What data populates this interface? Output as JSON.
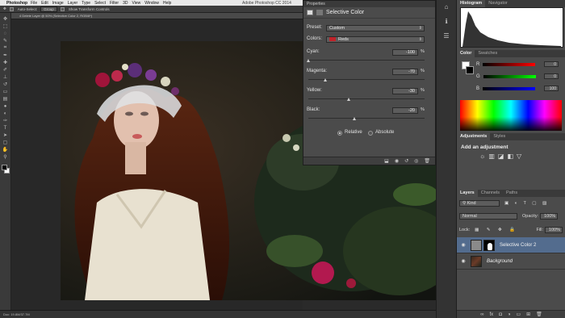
{
  "menubar": {
    "app": "Photoshop",
    "menus": [
      "File",
      "Edit",
      "Image",
      "Layer",
      "Type",
      "Select",
      "Filter",
      "3D",
      "View",
      "Window",
      "Help"
    ],
    "window_title": "Adobe Photoshop CC 2014"
  },
  "options_bar": {
    "auto_select_label": "Auto-Select:",
    "auto_select_value": "Group",
    "transform_label": "Show Transform Controls"
  },
  "document": {
    "tab_title": "4 Delete Layer @ 50% (Selective Color 2, RGB/8*)",
    "status": "Doc: 19.8M/37.7M"
  },
  "properties": {
    "tab": "Properties",
    "title": "Selective Color",
    "preset_label": "Preset:",
    "preset_value": "Custom",
    "colors_label": "Colors:",
    "colors_value": "Reds",
    "sliders": [
      {
        "label": "Cyan:",
        "value": "-100",
        "pos": 0.0
      },
      {
        "label": "Magenta:",
        "value": "-70",
        "pos": 0.15
      },
      {
        "label": "Yellow:",
        "value": "-30",
        "pos": 0.35
      },
      {
        "label": "Black:",
        "value": "-20",
        "pos": 0.4
      }
    ],
    "pct": "%",
    "method_relative": "Relative",
    "method_absolute": "Absolute",
    "method_selected": "Relative"
  },
  "histogram": {
    "tabs": [
      "Histogram",
      "Navigator"
    ]
  },
  "color": {
    "tabs": [
      "Color",
      "Swatches"
    ],
    "channels": [
      {
        "label": "R",
        "value": "0"
      },
      {
        "label": "G",
        "value": "0"
      },
      {
        "label": "B",
        "value": "100"
      }
    ]
  },
  "adjustments": {
    "tabs": [
      "Adjustments",
      "Styles"
    ],
    "heading": "Add an adjustment"
  },
  "layers": {
    "tabs": [
      "Layers",
      "Channels",
      "Paths"
    ],
    "filter_kind": "Kind",
    "blend_mode": "Normal",
    "opacity_label": "Opacity:",
    "opacity_value": "100%",
    "lock_label": "Lock:",
    "fill_label": "Fill:",
    "fill_value": "100%",
    "items": [
      {
        "name": "Selective Color 2",
        "selected": true
      },
      {
        "name": "Background",
        "selected": false
      }
    ]
  },
  "colors": {
    "panel_bg": "#4b4b4b",
    "selected_layer": "#536c8e",
    "reds_swatch": "#c0232a"
  }
}
